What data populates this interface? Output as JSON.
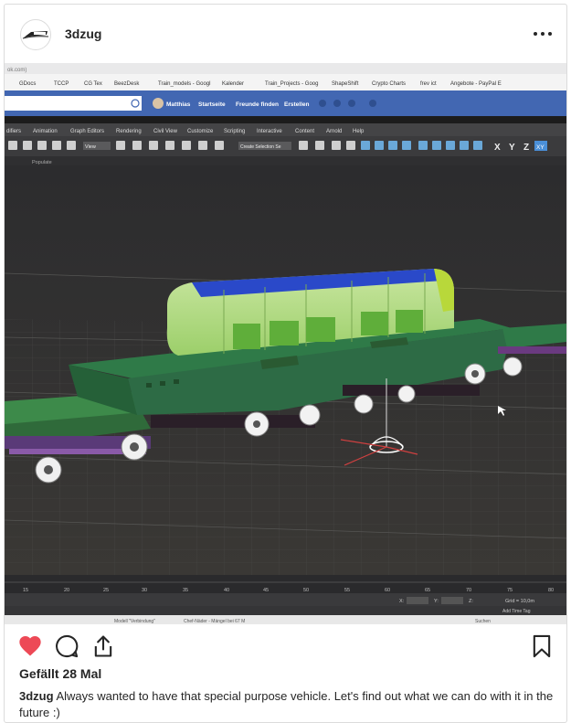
{
  "post": {
    "username": "3dzug",
    "likes_text": "Gefällt 28 Mal",
    "caption_user": "3dzug",
    "caption_text": "Always wanted to have that special purpose vehicle. Let's find out what we can do with it in the future :)"
  },
  "screen": {
    "bookmarks": [
      "GDocs",
      "TCCP",
      "CG Tex",
      "BeezDesk",
      "Train_models - Googl",
      "Kalender",
      "Train_Projects - Goog",
      "ShapeShift",
      "Crypto Charts",
      "frev ict",
      "Angebote - PayPal E"
    ],
    "fb_nav": [
      "Matthias",
      "Startseite",
      "Freunde finden",
      "Erstellen"
    ],
    "menu_items": [
      "difiers",
      "Animation",
      "Graph Editors",
      "Rendering",
      "Civil View",
      "Customize",
      "Scripting",
      "Interactive",
      "Content",
      "Arnold",
      "Help"
    ],
    "toolbar_view": "View",
    "toolbar_selection_set": "Create Selection Se",
    "axis_buttons": [
      "X",
      "Y",
      "Z",
      "XY"
    ],
    "ribbon_label": "Populate",
    "timeline_ticks": [
      "15",
      "20",
      "25",
      "30",
      "35",
      "40",
      "45",
      "50",
      "55",
      "60",
      "65",
      "70",
      "75",
      "80"
    ],
    "status_x_label": "X:",
    "status_y_label": "Y:",
    "status_z_label": "Z:",
    "grid_label": "Grid = 10,0m",
    "add_time_tag": "Add Time Tag",
    "search_label": "Suchen",
    "taskbar_text_1": "Chef-Näder - Mängel bei 67 M",
    "taskbar_text_2": "Modell \"Verbindung\""
  },
  "icons": {
    "like": "heart-icon",
    "comment": "comment-icon",
    "share": "share-icon",
    "save": "bookmark-icon",
    "more": "more-icon"
  },
  "colors": {
    "like": "#ed4956",
    "text": "#262626",
    "border": "#dbdbdb"
  }
}
